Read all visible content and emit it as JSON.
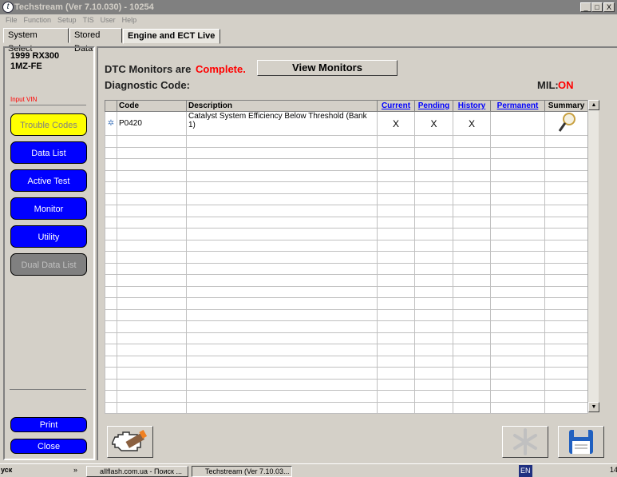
{
  "window": {
    "title": "Techstream (Ver 7.10.030) - 10254",
    "controls": [
      "_",
      "□",
      "X"
    ]
  },
  "menu": [
    "File",
    "Function",
    "Setup",
    "TIS",
    "User",
    "Help"
  ],
  "tabs": [
    "System Select",
    "Stored Data",
    "Engine and ECT Live"
  ],
  "sidebar": {
    "vehicle_line1": "1999 RX300",
    "vehicle_line2": "1MZ-FE",
    "input_vin": "Input VIN",
    "buttons": [
      "Trouble Codes",
      "Data List",
      "Active Test",
      "Monitor",
      "Utility",
      "Dual Data List"
    ],
    "print": "Print",
    "close": "Close"
  },
  "main": {
    "dtc_monitors_label": "DTC Monitors are",
    "dtc_monitors_status": "Complete.",
    "view_monitors": "View Monitors",
    "diagnostic_code_label": "Diagnostic Code:",
    "mil_label": "MIL:",
    "mil_status": "ON"
  },
  "table": {
    "headers": [
      "",
      "Code",
      "Description",
      "Current",
      "Pending",
      "History",
      "Permanent",
      "Summary"
    ],
    "rows": [
      {
        "code": "P0420",
        "description": "Catalyst System Efficiency Below Threshold (Bank 1)",
        "current": "X",
        "pending": "X",
        "history": "X",
        "permanent": ""
      }
    ]
  },
  "taskbar": {
    "start": "уск",
    "quick_more": "»",
    "tasks": [
      "allflash.com.ua - Поиск ...",
      "Techstream (Ver 7.10.03..."
    ],
    "lang": "EN",
    "clock": "14"
  },
  "colors": {
    "status_red": "#ff0000",
    "nav_blue": "#0000ff",
    "active_yellow": "#ffff00"
  }
}
